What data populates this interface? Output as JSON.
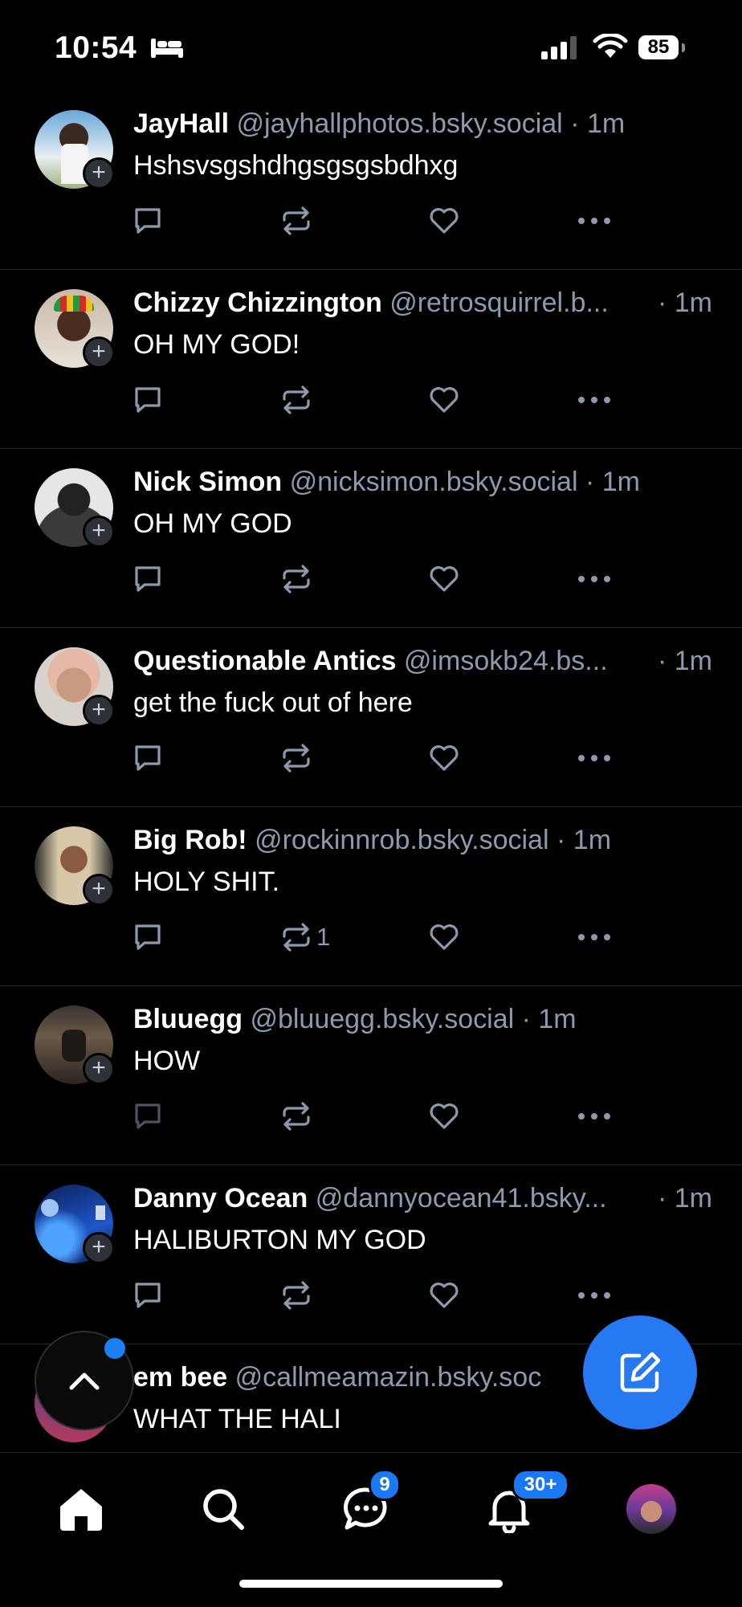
{
  "status_bar": {
    "time": "10:54",
    "battery": "85",
    "icons": [
      "bed-icon",
      "signal-icon",
      "wifi-icon",
      "battery-icon"
    ]
  },
  "posts": [
    {
      "name": "JayHall",
      "handle": "@jayhallphotos.bsky.social",
      "sep": " · ",
      "time": "1m",
      "text": "Hshsvsgshdhgsgsgsbdhxg",
      "repost_count": ""
    },
    {
      "name": "Chizzy Chizzington",
      "handle": "@retrosquirrel.b...",
      "sep": "",
      "time": "· 1m",
      "text": "OH MY GOD!",
      "repost_count": ""
    },
    {
      "name": "Nick Simon",
      "handle": "@nicksimon.bsky.social",
      "sep": " · ",
      "time": "1m",
      "text": "OH MY GOD",
      "repost_count": ""
    },
    {
      "name": "Questionable Antics",
      "handle": "@imsokb24.bs...",
      "sep": "",
      "time": "· 1m",
      "text": "get the fuck out of here",
      "repost_count": ""
    },
    {
      "name": "Big Rob!",
      "handle": "@rockinnrob.bsky.social",
      "sep": " · ",
      "time": "1m",
      "text": "HOLY SHIT.",
      "repost_count": "1"
    },
    {
      "name": "Bluuegg",
      "handle": "@bluuegg.bsky.social",
      "sep": " · ",
      "time": "1m",
      "text": "HOW",
      "repost_count": ""
    },
    {
      "name": "Danny Ocean",
      "handle": "@dannyocean41.bsky...",
      "sep": "",
      "time": "· 1m",
      "text": "HALIBURTON MY GOD",
      "repost_count": ""
    },
    {
      "name": "em bee",
      "handle": "@callmeamazin.bsky.soc",
      "sep": "",
      "time": "",
      "text": "WHAT THE HALI",
      "repost_count": ""
    }
  ],
  "tabbar": {
    "messages_badge": "9",
    "notifications_badge": "30+"
  },
  "colors": {
    "accent": "#2779f2",
    "muted": "#8d9aab",
    "background": "#000000"
  }
}
